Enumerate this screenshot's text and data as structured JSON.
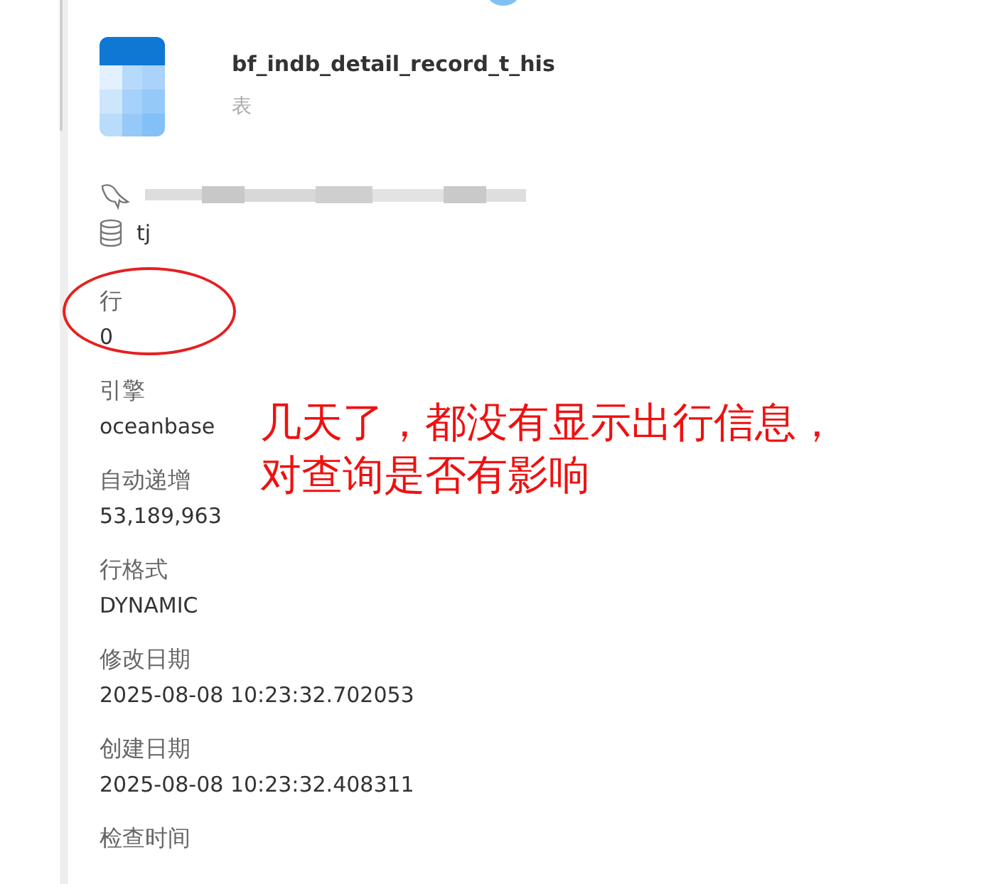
{
  "object": {
    "name": "bf_indb_detail_record_t_his",
    "type": "表"
  },
  "database": "tj",
  "properties": [
    {
      "label": "行",
      "value": "0",
      "circled": true
    },
    {
      "label": "引擎",
      "value": "oceanbase",
      "circled": false
    },
    {
      "label": "自动递增",
      "value": "53,189,963",
      "circled": false
    },
    {
      "label": "行格式",
      "value": "DYNAMIC",
      "circled": false
    },
    {
      "label": "修改日期",
      "value": "2025-08-08 10:23:32.702053",
      "circled": false
    },
    {
      "label": "创建日期",
      "value": "2025-08-08 10:23:32.408311",
      "circled": false
    },
    {
      "label": "检查时间",
      "circled": false
    }
  ],
  "annotation": [
    "几天了，都没有显示出行信息，",
    "对查询是否有影响"
  ]
}
